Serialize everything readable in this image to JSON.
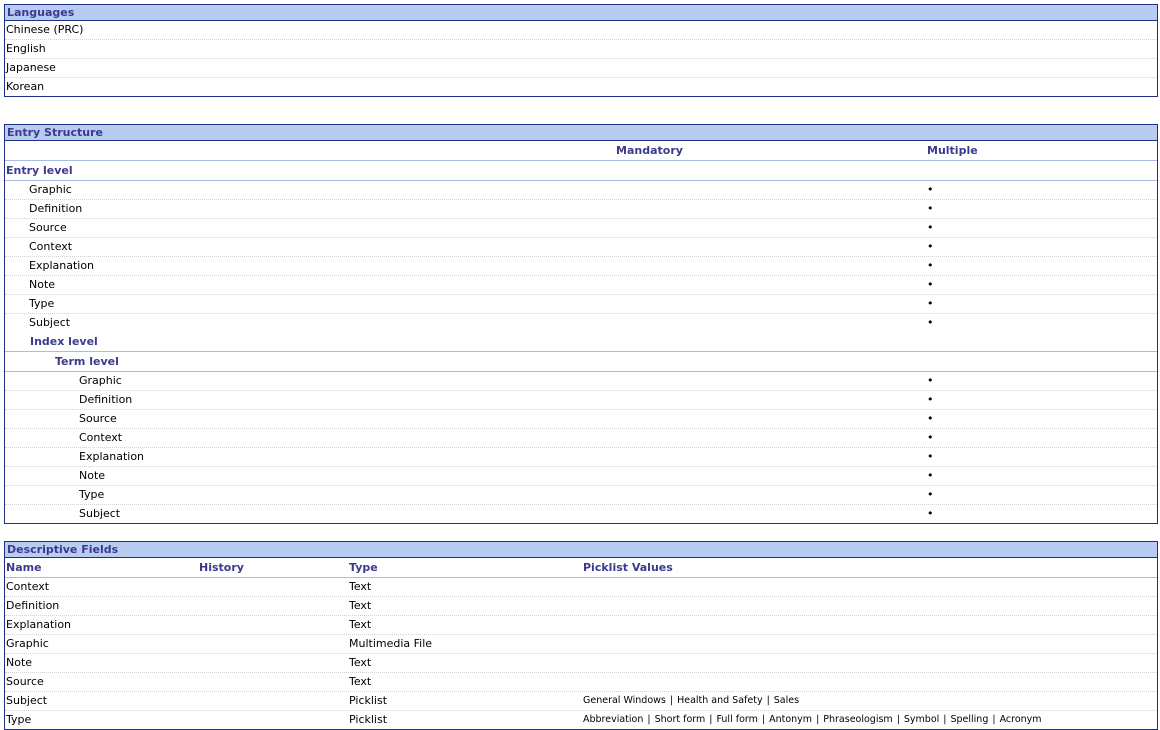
{
  "languages": {
    "title": "Languages",
    "items": [
      "Chinese (PRC)",
      "English",
      "Japanese",
      "Korean"
    ]
  },
  "entry_structure": {
    "title": "Entry Structure",
    "columns": {
      "mandatory": "Mandatory",
      "multiple": "Multiple"
    },
    "entry_level": {
      "label": "Entry level",
      "fields": [
        "Graphic",
        "Definition",
        "Source",
        "Context",
        "Explanation",
        "Note",
        "Type",
        "Subject"
      ],
      "multiple_marker": "•"
    },
    "index_level": {
      "label": "Index level"
    },
    "term_level": {
      "label": "Term level",
      "fields": [
        "Graphic",
        "Definition",
        "Source",
        "Context",
        "Explanation",
        "Note",
        "Type",
        "Subject"
      ],
      "multiple_marker": "•"
    }
  },
  "descriptive_fields": {
    "title": "Descriptive Fields",
    "columns": {
      "name": "Name",
      "history": "History",
      "type": "Type",
      "picklist": "Picklist Values"
    },
    "rows": [
      {
        "name": "Context",
        "type": "Text",
        "picklist": []
      },
      {
        "name": "Definition",
        "type": "Text",
        "picklist": []
      },
      {
        "name": "Explanation",
        "type": "Text",
        "picklist": []
      },
      {
        "name": "Graphic",
        "type": "Multimedia File",
        "picklist": []
      },
      {
        "name": "Note",
        "type": "Text",
        "picklist": []
      },
      {
        "name": "Source",
        "type": "Text",
        "picklist": []
      },
      {
        "name": "Subject",
        "type": "Picklist",
        "picklist": [
          "General Windows",
          "Health and Safety",
          "Sales"
        ]
      },
      {
        "name": "Type",
        "type": "Picklist",
        "picklist": [
          "Abbreviation",
          "Short form",
          "Full form",
          "Antonym",
          "Phraseologism",
          "Symbol",
          "Spelling",
          "Acronym"
        ]
      }
    ]
  },
  "colors": {
    "header_bg": "#b8ccf2",
    "header_text": "#3b3a8e",
    "border": "#1f2f86"
  }
}
